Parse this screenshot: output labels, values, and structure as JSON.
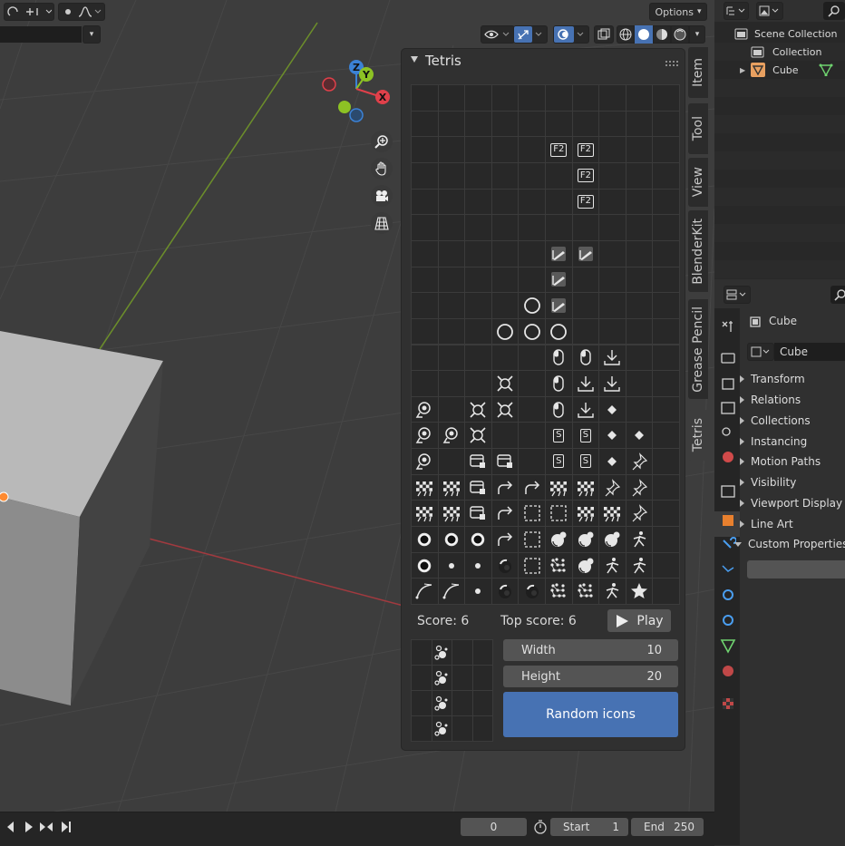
{
  "header": {
    "options_label": "Options"
  },
  "sidebar_tabs": [
    "Item",
    "Tool",
    "View",
    "BlenderKit",
    "Grease Pencil",
    "Tetris"
  ],
  "panel": {
    "title": "Tetris",
    "score_label": "Score: 6",
    "top_score_label": "Top score: 6",
    "play_label": "Play",
    "width_label": "Width",
    "width_value": "10",
    "height_label": "Height",
    "height_value": "20",
    "random_icons_label": "Random icons"
  },
  "board": {
    "cols": 10,
    "rows": 20,
    "cells": [
      [
        2,
        5,
        "chip",
        "F2"
      ],
      [
        2,
        6,
        "chip",
        "F2"
      ],
      [
        3,
        6,
        "chip",
        "F2"
      ],
      [
        4,
        6,
        "chip",
        "F2"
      ],
      [
        6,
        5,
        "pencil",
        ""
      ],
      [
        6,
        6,
        "pencil",
        ""
      ],
      [
        7,
        5,
        "pencil",
        ""
      ],
      [
        8,
        5,
        "pencil",
        ""
      ],
      [
        8,
        4,
        "circle",
        ""
      ],
      [
        9,
        3,
        "circle",
        ""
      ],
      [
        9,
        4,
        "circle",
        ""
      ],
      [
        9,
        5,
        "circle",
        ""
      ],
      [
        10,
        5,
        "mouse",
        ""
      ],
      [
        10,
        6,
        "mouse",
        ""
      ],
      [
        10,
        7,
        "download",
        ""
      ],
      [
        11,
        3,
        "cross",
        ""
      ],
      [
        11,
        5,
        "mouse",
        ""
      ],
      [
        11,
        6,
        "download",
        ""
      ],
      [
        11,
        7,
        "download",
        ""
      ],
      [
        12,
        0,
        "magnifier",
        ""
      ],
      [
        12,
        2,
        "cross",
        ""
      ],
      [
        12,
        3,
        "cross",
        ""
      ],
      [
        12,
        5,
        "mouse",
        ""
      ],
      [
        12,
        6,
        "download",
        ""
      ],
      [
        12,
        7,
        "diamond",
        ""
      ],
      [
        13,
        0,
        "magnifier",
        ""
      ],
      [
        13,
        1,
        "magnifier",
        ""
      ],
      [
        13,
        2,
        "cross",
        ""
      ],
      [
        13,
        5,
        "chip",
        "S"
      ],
      [
        13,
        6,
        "chip",
        "S"
      ],
      [
        13,
        7,
        "diamond",
        ""
      ],
      [
        13,
        8,
        "diamond",
        ""
      ],
      [
        14,
        0,
        "magnifier",
        ""
      ],
      [
        14,
        2,
        "panel",
        ""
      ],
      [
        14,
        3,
        "panel",
        ""
      ],
      [
        14,
        5,
        "chip",
        "S"
      ],
      [
        14,
        6,
        "chip",
        "S"
      ],
      [
        14,
        7,
        "diamond",
        ""
      ],
      [
        14,
        8,
        "pin",
        ""
      ],
      [
        15,
        0,
        "checker",
        ""
      ],
      [
        15,
        1,
        "checker",
        ""
      ],
      [
        15,
        2,
        "panel",
        ""
      ],
      [
        15,
        3,
        "redo",
        ""
      ],
      [
        15,
        4,
        "redo",
        ""
      ],
      [
        15,
        5,
        "checker",
        ""
      ],
      [
        15,
        6,
        "checker",
        ""
      ],
      [
        15,
        7,
        "pin",
        ""
      ],
      [
        15,
        8,
        "pin",
        ""
      ],
      [
        16,
        0,
        "checker",
        ""
      ],
      [
        16,
        1,
        "checker",
        ""
      ],
      [
        16,
        2,
        "panel",
        ""
      ],
      [
        16,
        3,
        "redo",
        ""
      ],
      [
        16,
        4,
        "dashsq",
        ""
      ],
      [
        16,
        5,
        "dashsq",
        ""
      ],
      [
        16,
        6,
        "checker",
        ""
      ],
      [
        16,
        7,
        "checker",
        ""
      ],
      [
        16,
        8,
        "pin",
        ""
      ],
      [
        17,
        0,
        "dotring",
        ""
      ],
      [
        17,
        1,
        "dotring",
        ""
      ],
      [
        17,
        2,
        "dotring",
        ""
      ],
      [
        17,
        3,
        "redo",
        ""
      ],
      [
        17,
        4,
        "dashsq",
        ""
      ],
      [
        17,
        5,
        "metaball",
        ""
      ],
      [
        17,
        6,
        "metaball",
        ""
      ],
      [
        17,
        7,
        "metaball",
        ""
      ],
      [
        17,
        8,
        "figure",
        ""
      ],
      [
        18,
        0,
        "dotring",
        ""
      ],
      [
        18,
        1,
        "dot",
        ""
      ],
      [
        18,
        2,
        "dot",
        ""
      ],
      [
        18,
        3,
        "sphere",
        ""
      ],
      [
        18,
        4,
        "dashsq",
        ""
      ],
      [
        18,
        5,
        "dotnet",
        ""
      ],
      [
        18,
        6,
        "metaball",
        ""
      ],
      [
        18,
        7,
        "figure",
        ""
      ],
      [
        18,
        8,
        "figure",
        ""
      ],
      [
        19,
        0,
        "curve",
        ""
      ],
      [
        19,
        1,
        "curve",
        ""
      ],
      [
        19,
        2,
        "dot",
        ""
      ],
      [
        19,
        3,
        "sphere",
        ""
      ],
      [
        19,
        4,
        "sphere",
        ""
      ],
      [
        19,
        5,
        "dotnet",
        ""
      ],
      [
        19,
        6,
        "dotnet",
        ""
      ],
      [
        19,
        7,
        "figure",
        ""
      ],
      [
        19,
        8,
        "star",
        ""
      ]
    ]
  },
  "preview": {
    "cols": 4,
    "rows": 4,
    "cells": [
      [
        0,
        1,
        "particles"
      ],
      [
        1,
        1,
        "particles"
      ],
      [
        2,
        1,
        "particles"
      ],
      [
        3,
        1,
        "particles"
      ]
    ]
  },
  "outliner": {
    "scene_collection": "Scene Collection",
    "collection": "Collection",
    "object": "Cube"
  },
  "properties": {
    "object_name": "Cube",
    "object_field": "Cube",
    "sections": [
      "Transform",
      "Relations",
      "Collections",
      "Instancing",
      "Motion Paths",
      "Visibility",
      "Viewport Display",
      "Line Art",
      "Custom Properties"
    ]
  },
  "timeline": {
    "current_frame": "0",
    "start_label": "Start",
    "start_value": "1",
    "end_label": "End",
    "end_value": "250"
  },
  "colors": {
    "accent": "#4772b3",
    "x_axis": "#e0404a",
    "y_axis": "#8dc224",
    "z_axis": "#3b82d6"
  }
}
